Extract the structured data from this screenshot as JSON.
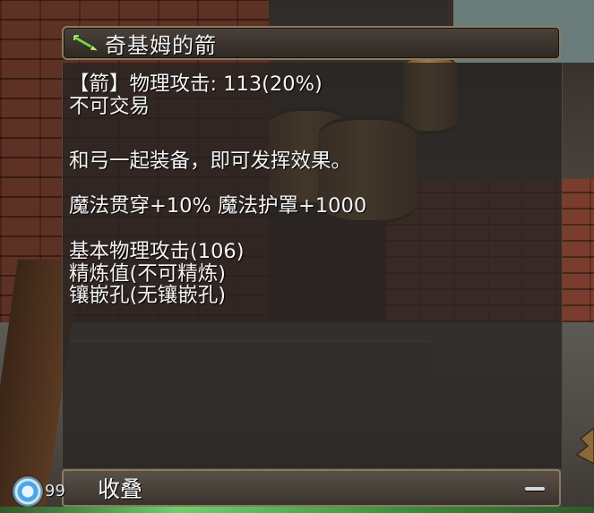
{
  "item": {
    "title": "奇基姆的箭",
    "icon": "arrow-icon"
  },
  "tooltip": {
    "line1": "【箭】物理攻击: 113(20%)",
    "line2": "不可交易",
    "line3": "和弓一起装备，即可发挥效果。",
    "line4": "魔法贯穿+10% 魔法护罩+1000",
    "line5": "基本物理攻击(106)",
    "line6": "精炼值(不可精炼)",
    "line7": "镶嵌孔(无镶嵌孔)"
  },
  "collapse": {
    "label": "收叠",
    "button_icon": "minus-icon"
  },
  "hud": {
    "number": "99"
  },
  "colors": {
    "text": "#f4f4f4",
    "frame": "#8a7a5e",
    "icon_green": "#7ad14a"
  }
}
